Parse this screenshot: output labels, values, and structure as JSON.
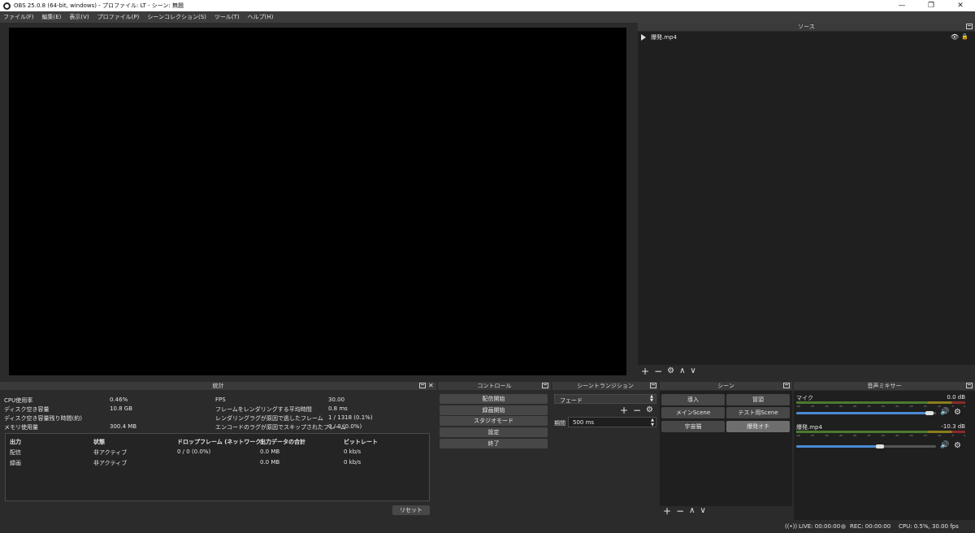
{
  "window": {
    "title": "OBS 25.0.8 (64-bit, windows) - プロファイル: LT - シーン: 無題",
    "buttons": {
      "minimize": "—",
      "restore": "❐",
      "close": "✕"
    }
  },
  "menu": [
    "ファイル(F)",
    "編集(E)",
    "表示(V)",
    "プロファイル(P)",
    "シーンコレクション(S)",
    "ツール(T)",
    "ヘルプ(H)"
  ],
  "sources": {
    "title": "ソース",
    "items": [
      {
        "name": "爆発.mp4"
      }
    ],
    "toolbar": [
      "+",
      "−",
      "⚙",
      "∧",
      "∨"
    ]
  },
  "stats": {
    "title": "統計",
    "left": [
      {
        "label": "CPU使用率",
        "value": "0.46%"
      },
      {
        "label": "ディスク空き容量",
        "value": "10.8 GB"
      },
      {
        "label": "ディスク空き容量残り時間(約)",
        "value": ""
      },
      {
        "label": "メモリ使用量",
        "value": "300.4 MB"
      }
    ],
    "right": [
      {
        "label": "FPS",
        "value": "30.00"
      },
      {
        "label": "フレームをレンダリングする平均時間",
        "value": "0.8 ms"
      },
      {
        "label": "レンダリングラグが原因で逃したフレーム",
        "value": "1 / 1318 (0.1%)"
      },
      {
        "label": "エンコードのラグが原因でスキップされたフレーム",
        "value": "0 / 0 (0.0%)"
      }
    ],
    "table": {
      "headers": [
        "出力",
        "状態",
        "ドロップフレーム (ネットワーク)",
        "出力データの合計",
        "ビットレート"
      ],
      "rows": [
        [
          "配信",
          "非アクティブ",
          "0 / 0 (0.0%)",
          "0.0 MB",
          "0 kb/s"
        ],
        [
          "録画",
          "非アクティブ",
          "",
          "0.0 MB",
          "0 kb/s"
        ]
      ]
    },
    "reset_label": "リセット"
  },
  "controls": {
    "title": "コントロール",
    "buttons": [
      "配信開始",
      "録画開始",
      "スタジオモード",
      "設定",
      "終了"
    ]
  },
  "transition": {
    "title": "シーントランジション",
    "selected": "フェード",
    "duration_label": "期間",
    "duration_value": "500 ms"
  },
  "scenes": {
    "title": "シーン",
    "items": [
      "導入",
      "冒頭",
      "メインScene",
      "テスト用Scene",
      "宇宙猫",
      "爆発オチ"
    ],
    "selected_index": 5
  },
  "mixer": {
    "title": "音声ミキサー",
    "tracks": [
      {
        "name": "マイク",
        "db": "0.0 dB",
        "volume": 0.98
      },
      {
        "name": "爆発.mp4",
        "db": "-10.3 dB",
        "volume": 0.63
      }
    ],
    "ticks": [
      "-60",
      "-55",
      "-50",
      "-45",
      "-40",
      "-35",
      "-30",
      "-25",
      "-20",
      "-15",
      "-10",
      "-5",
      "0"
    ]
  },
  "status": {
    "live": "LIVE: 00:00:00",
    "rec": "REC: 00:00:00",
    "cpu": "CPU: 0.5%, 30.00 fps"
  }
}
